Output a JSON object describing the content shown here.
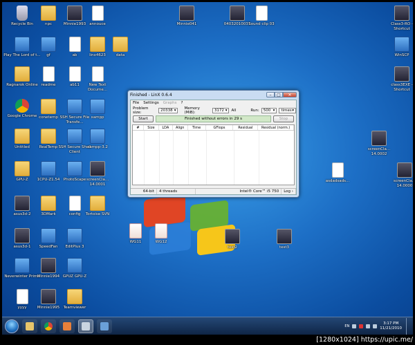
{
  "desktop": {
    "icons": [
      {
        "label": "Recycle Bin",
        "type": "recycle"
      },
      {
        "label": "npc",
        "type": "folder"
      },
      {
        "label": "Minnie1993",
        "type": "img"
      },
      {
        "label": "annouce",
        "type": "doc"
      },
      {
        "label": "Play The Lord of t...",
        "type": "app"
      },
      {
        "label": "gf",
        "type": "app"
      },
      {
        "label": "ab",
        "type": "doc"
      },
      {
        "label": "linx4623",
        "type": "folder"
      },
      {
        "label": "data",
        "type": "folder"
      },
      {
        "label": "Ragnarok Online",
        "type": "folder"
      },
      {
        "label": "readme",
        "type": "doc"
      },
      {
        "label": "ab11",
        "type": "doc"
      },
      {
        "label": "New Text Docume...",
        "type": "doc"
      },
      {
        "label": "Google Chrome",
        "type": "chrome"
      },
      {
        "label": "conetemp",
        "type": "folder"
      },
      {
        "label": "SSH Secure File Transfe...",
        "type": "app"
      },
      {
        "label": "xampp",
        "type": "app"
      },
      {
        "label": "Untitled",
        "type": "folder"
      },
      {
        "label": "RealTemp",
        "type": "folder"
      },
      {
        "label": "SSH Secure Shell Client",
        "type": "app"
      },
      {
        "label": "xampp-3.2",
        "type": "app"
      },
      {
        "label": "GPU-Z",
        "type": "folder"
      },
      {
        "label": "1CPU-Z1.54",
        "type": "app"
      },
      {
        "label": "PhotoScape",
        "type": "app"
      },
      {
        "label": "screenCla... 14.0001",
        "type": "img"
      },
      {
        "label": "screenCla... 14.0002",
        "type": "img"
      },
      {
        "label": "asdadsads...",
        "type": "doc"
      },
      {
        "label": "screenCla... 14.0000",
        "type": "img"
      },
      {
        "label": "asus3d-2",
        "type": "img"
      },
      {
        "label": "3DMark",
        "type": "folder"
      },
      {
        "label": "config",
        "type": "doc"
      },
      {
        "label": "Tortoise SVN",
        "type": "folder"
      },
      {
        "label": "asus3d-1",
        "type": "img"
      },
      {
        "label": "SpeedFan",
        "type": "app"
      },
      {
        "label": "EditPlus 3",
        "type": "app"
      },
      {
        "label": "WG11",
        "type": "ppt"
      },
      {
        "label": "WG12",
        "type": "ppt"
      },
      {
        "label": "test2",
        "type": "img"
      },
      {
        "label": "test3",
        "type": "img"
      },
      {
        "label": "Neverwinter Prime",
        "type": "app"
      },
      {
        "label": "Minnie1994",
        "type": "img"
      },
      {
        "label": "GPUZ GPU-Z",
        "type": "app"
      },
      {
        "label": "yyyy",
        "type": "doc"
      },
      {
        "label": "Minnie1995",
        "type": "img"
      },
      {
        "label": "Teamviewer",
        "type": "folder"
      },
      {
        "label": "Minnie041",
        "type": "img"
      },
      {
        "label": "04032010031",
        "type": "img"
      },
      {
        "label": "Sound clip 03",
        "type": "doc"
      },
      {
        "label": "Class3-RO - Shortcut",
        "type": "img"
      },
      {
        "label": "WinSCP",
        "type": "app"
      },
      {
        "label": "class3EXE - Shortcut",
        "type": "img"
      }
    ]
  },
  "window": {
    "title": "Finished - LinX 0.6.4",
    "min": "–",
    "max": "□",
    "close": "✕",
    "menu": {
      "file": "File",
      "settings": "Settings",
      "graphs": "Graphs",
      "help": "?"
    },
    "problem_size_label": "Problem size:",
    "problem_size_value": "20338",
    "memory_label": "Memory (MiB):",
    "memory_value": "3172",
    "all_label": "All",
    "run_label": "Run:",
    "run_value": "500",
    "run_unit": "times",
    "start_label": "Start",
    "status_text": "Finished without errors in 29 s",
    "stop_label": "Stop",
    "columns": [
      "#",
      "Size",
      "LDA",
      "Align",
      "Time",
      "GFlops",
      "Residual",
      "Residual (norm.)"
    ],
    "statusbar": {
      "bits": "64-bit",
      "threads": "4 threads",
      "cpu": "Intel® Core™ i5 750",
      "log": "Log ›"
    }
  },
  "taskbar": {
    "lang": "EN",
    "time": "3:17 PM",
    "date": "11/21/2010"
  },
  "watermark": "[1280x1024] https://upic.me/"
}
